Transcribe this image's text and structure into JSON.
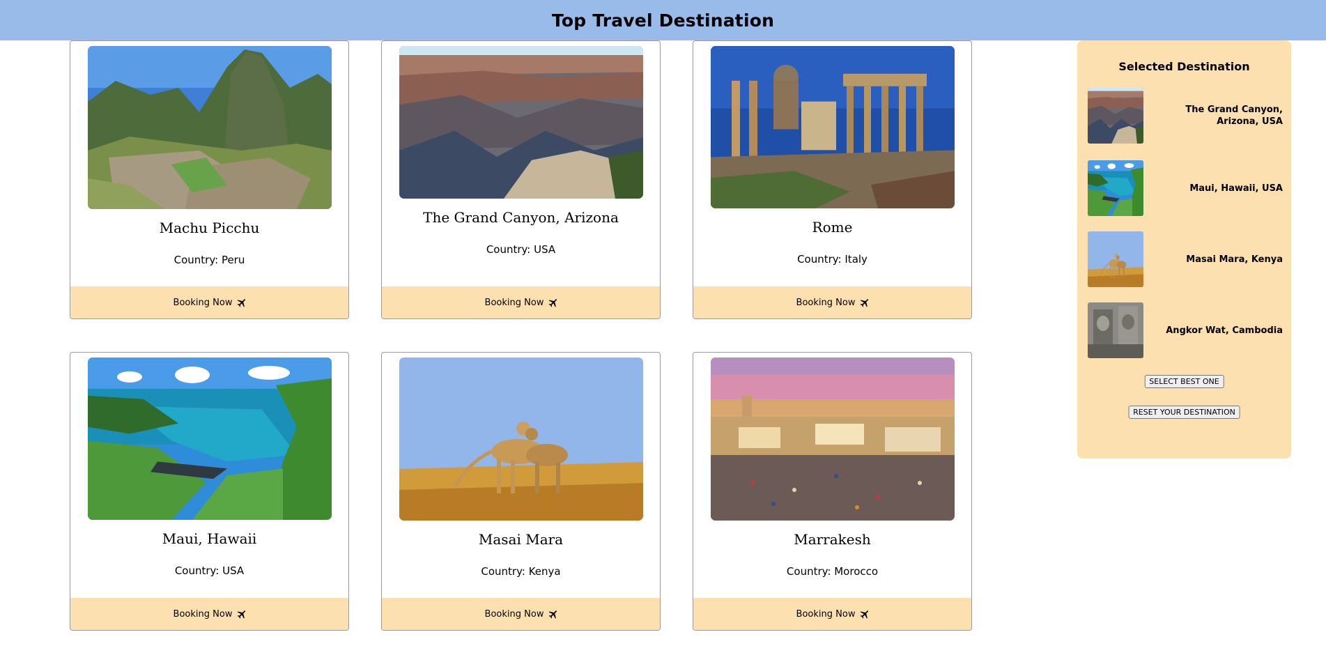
{
  "header": {
    "title": "Top Travel Destination"
  },
  "destinations": [
    {
      "name": "Machu Picchu",
      "country_label": "Country: Peru",
      "booking_label": "Booking Now",
      "booking_icon": "airplane-icon",
      "image": "machu-picchu-photo"
    },
    {
      "name": "The Grand Canyon, Arizona",
      "country_label": "Country: USA",
      "booking_label": "Booking Now",
      "booking_icon": "airplane-icon",
      "image": "grand-canyon-photo"
    },
    {
      "name": "Rome",
      "country_label": "Country: Italy",
      "booking_label": "Booking Now",
      "booking_icon": "airplane-icon",
      "image": "rome-photo"
    },
    {
      "name": "Maui, Hawaii",
      "country_label": "Country: USA",
      "booking_label": "Booking Now",
      "booking_icon": "airplane-icon",
      "image": "maui-photo"
    },
    {
      "name": "Masai Mara",
      "country_label": "Country: Kenya",
      "booking_label": "Booking Now",
      "booking_icon": "airplane-icon",
      "image": "masai-mara-photo"
    },
    {
      "name": "Marrakesh",
      "country_label": "Country: Morocco",
      "booking_label": "Booking Now",
      "booking_icon": "airplane-icon",
      "image": "marrakesh-photo"
    }
  ],
  "sidebar": {
    "title": "Selected Destination",
    "selected": [
      {
        "label": "The Grand Canyon, Arizona, USA",
        "image": "grand-canyon-thumb"
      },
      {
        "label": "Maui, Hawaii, USA",
        "image": "maui-thumb"
      },
      {
        "label": "Masai Mara, Kenya",
        "image": "masai-mara-thumb"
      },
      {
        "label": "Angkor Wat, Cambodia",
        "image": "angkor-wat-thumb"
      }
    ],
    "select_best_label": "SELECT BEST ONE",
    "reset_label": "RESET YOUR DESTINATION"
  },
  "colors": {
    "header_bg": "#99bbea",
    "accent_peach": "#fde0af",
    "card_border": "#9a9a9a"
  }
}
